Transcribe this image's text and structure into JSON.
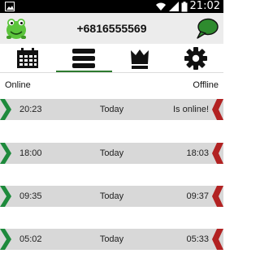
{
  "statusbar": {
    "time": "21:02"
  },
  "header": {
    "phone": "+6816555569"
  },
  "tabs": [
    {
      "name": "calendar"
    },
    {
      "name": "list",
      "active": true
    },
    {
      "name": "crown"
    },
    {
      "name": "settings"
    }
  ],
  "columns": {
    "left": "Online",
    "right": "Offline"
  },
  "sessions": [
    {
      "online": "20:23",
      "day": "Today",
      "offline": "Is online!"
    },
    {
      "online": "18:00",
      "day": "Today",
      "offline": "18:03"
    },
    {
      "online": "09:35",
      "day": "Today",
      "offline": "09:37"
    },
    {
      "online": "05:02",
      "day": "Today",
      "offline": "05:33"
    }
  ],
  "colors": {
    "accent": "#2d7a2f",
    "online_arrow": "#1e8a3c",
    "offline_arrow": "#b22222",
    "row_bg": "#d8d8d8"
  }
}
